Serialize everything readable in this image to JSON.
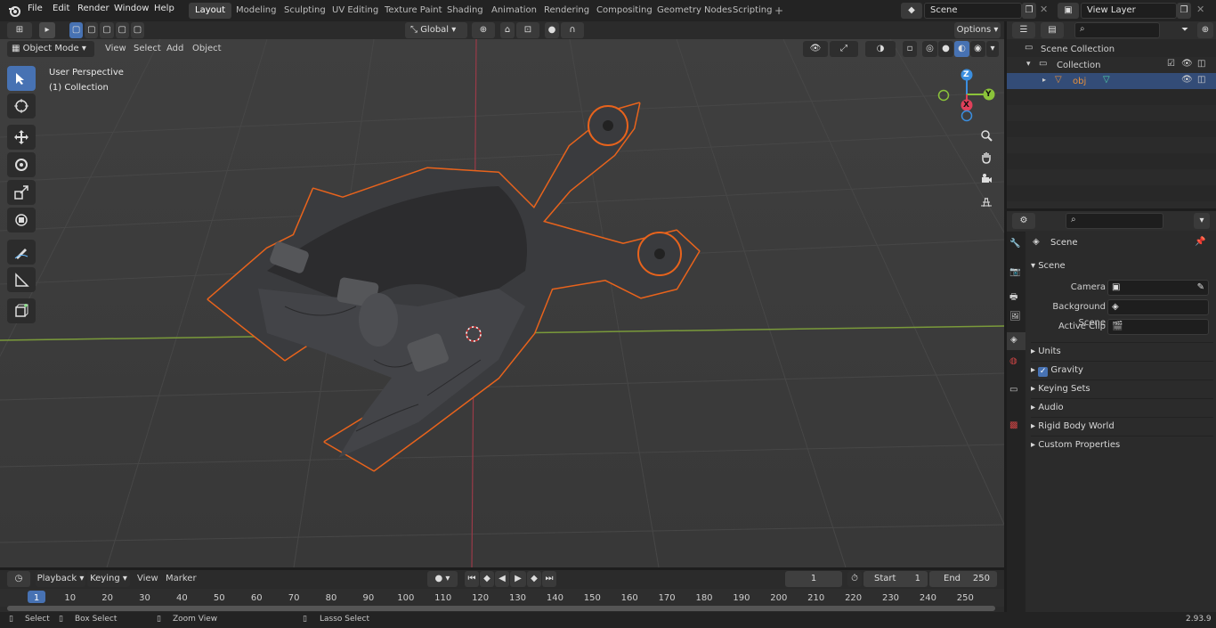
{
  "menus": [
    "File",
    "Edit",
    "Render",
    "Window",
    "Help"
  ],
  "workspaces": [
    "Layout",
    "Modeling",
    "Sculpting",
    "UV Editing",
    "Texture Paint",
    "Shading",
    "Animation",
    "Rendering",
    "Compositing",
    "Geometry Nodes",
    "Scripting"
  ],
  "active_workspace": "Layout",
  "scene_field": "Scene",
  "view_layer_field": "View Layer",
  "viewport_header": {
    "mode": "Object Mode",
    "menus": [
      "View",
      "Select",
      "Add",
      "Object"
    ],
    "transform": "Global",
    "options": "Options"
  },
  "viewport_overlay": {
    "line1": "User Perspective",
    "line2": "(1) Collection"
  },
  "gizmo": {
    "z": "Z",
    "y": "Y",
    "x": "X"
  },
  "outliner": {
    "search_placeholder": "",
    "rows": [
      {
        "label": "Scene Collection"
      },
      {
        "label": "Collection"
      },
      {
        "label": "obj"
      }
    ]
  },
  "properties": {
    "header": "Scene",
    "panel": "Scene",
    "fields": [
      {
        "label": "Camera"
      },
      {
        "label": "Background Scene"
      },
      {
        "label": "Active Clip"
      }
    ],
    "sections": [
      {
        "label": "Units",
        "checkbox": false
      },
      {
        "label": "Gravity",
        "checkbox": true
      },
      {
        "label": "Keying Sets",
        "checkbox": false
      },
      {
        "label": "Audio",
        "checkbox": false
      },
      {
        "label": "Rigid Body World",
        "checkbox": false
      },
      {
        "label": "Custom Properties",
        "checkbox": false
      }
    ]
  },
  "timeline": {
    "menus": [
      "Playback",
      "Keying",
      "View",
      "Marker"
    ],
    "current_frame": "1",
    "start_label": "Start",
    "start": "1",
    "end_label": "End",
    "end": "250",
    "ticks": [
      "1",
      "10",
      "20",
      "30",
      "40",
      "50",
      "60",
      "70",
      "80",
      "90",
      "100",
      "110",
      "120",
      "130",
      "140",
      "150",
      "160",
      "170",
      "180",
      "190",
      "200",
      "210",
      "220",
      "230",
      "240",
      "250"
    ]
  },
  "statusbar": {
    "select": "Select",
    "box_select": "Box Select",
    "zoom_view": "Zoom View",
    "lasso_select": "Lasso Select",
    "version": "2.93.9"
  },
  "colors": {
    "accent": "#4772b3",
    "selection_outline": "#e8631c",
    "x_axis": "#e0405a",
    "y_axis": "#8bc43a",
    "z_axis": "#3b8fe0"
  }
}
